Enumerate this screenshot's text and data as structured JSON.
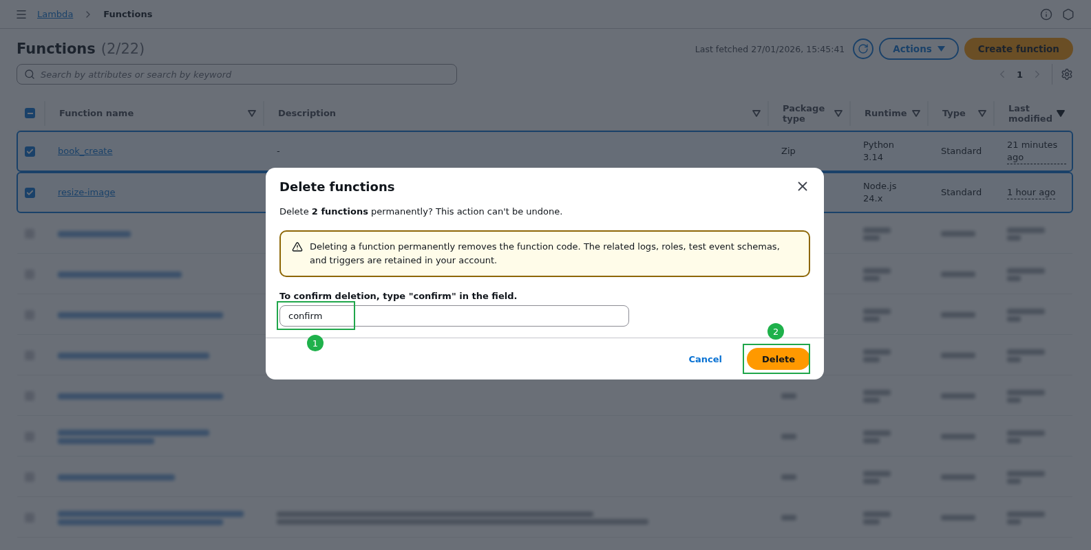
{
  "breadcrumbs": [
    {
      "label": "Lambda",
      "kind": "link"
    },
    {
      "label": "Functions",
      "kind": "current"
    }
  ],
  "page": {
    "title": "Functions",
    "count": "(2/22)",
    "last_fetched": "Last fetched 27/01/2026, 15:45:41",
    "actions_button": "Actions",
    "create_button": "Create function",
    "search": {
      "placeholder": "Search by attributes or search by keyword"
    },
    "pagination": {
      "current": "1"
    }
  },
  "table": {
    "select_all": {
      "indeterminate": true
    },
    "columns": [
      {
        "label": "Function name",
        "sorted": false
      },
      {
        "label": "Description",
        "sorted": false
      },
      {
        "label": "Package type",
        "sorted": false
      },
      {
        "label": "Runtime",
        "sorted": false
      },
      {
        "label": "Type",
        "sorted": false
      },
      {
        "label": "Last modified",
        "sorted": true
      }
    ],
    "rows": [
      {
        "name": "book_create",
        "description": "-",
        "package_type": "Zip",
        "runtime": "Python 3.14",
        "type": "Standard",
        "last_modified": "21 minutes ago",
        "selected": true
      },
      {
        "name": "resize-image",
        "runtime": "Node.js 24.x",
        "type": "Standard",
        "last_modified": "1 hour ago",
        "selected": true
      }
    ],
    "blurred_rows": [
      {
        "kind": "short",
        "selected": false
      },
      {
        "kind": "short",
        "selected": false
      },
      {
        "kind": "short",
        "selected": false
      },
      {
        "kind": "short",
        "selected": false
      },
      {
        "kind": "short",
        "selected": false
      },
      {
        "kind": "double",
        "selected": false
      },
      {
        "kind": "short",
        "selected": false
      },
      {
        "kind": "described",
        "selected": false
      }
    ]
  },
  "dialog": {
    "title": "Delete functions",
    "message": "Delete **2 functions** permanently? This action can't be undone.",
    "warning": "Deleting a function permanently removes the function code. The related logs, roles, test event schemas, and triggers are retained in your account.",
    "confirm_label": "To confirm deletion, type \"confirm\" in the field.",
    "confirm_value": "confirm",
    "cancel_button": "Cancel",
    "delete_button": "Delete",
    "input_marker": "1",
    "delete_marker": "2"
  }
}
